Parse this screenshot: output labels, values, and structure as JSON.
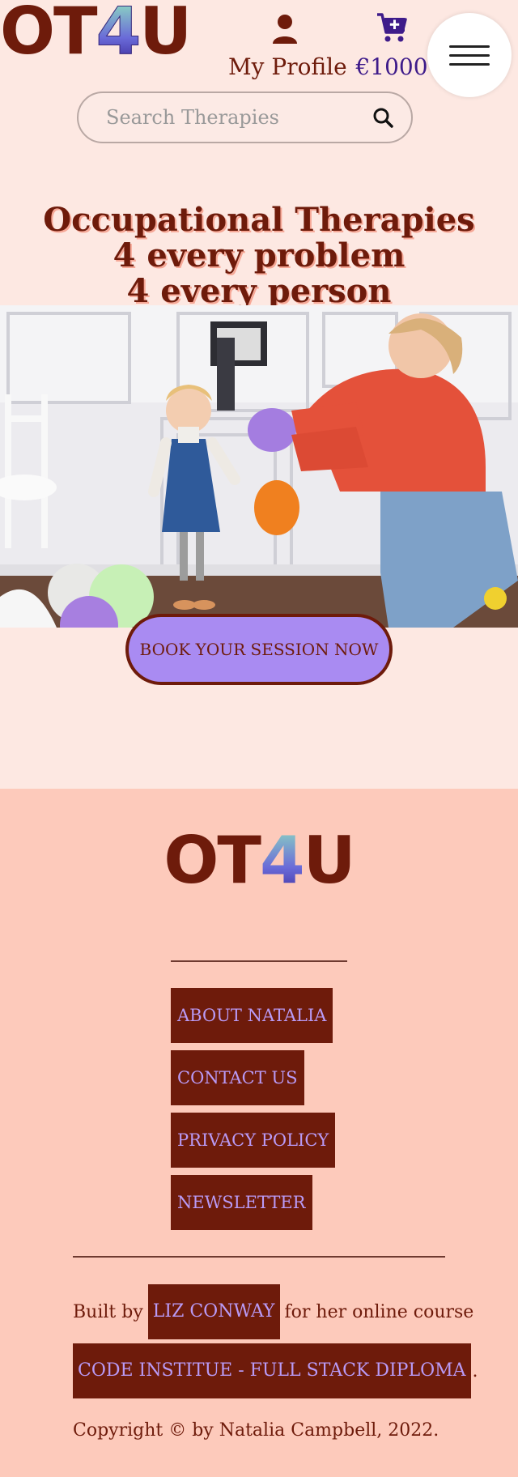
{
  "header": {
    "logo_text": "OT",
    "logo_four": "4",
    "logo_tail": "U",
    "profile_label": "My Profile",
    "cart_total": "€1000"
  },
  "search": {
    "placeholder": "Search Therapies"
  },
  "hero": {
    "line1": "Occupational Therapies",
    "line2": "4 every problem",
    "line3": "4 every person",
    "book_button": "BOOK YOUR SESSION NOW"
  },
  "footer": {
    "logo_text": "OT",
    "logo_four": "4",
    "logo_tail": "U",
    "nav": [
      "ABOUT NATALIA",
      "CONTACT US",
      "PRIVACY POLICY",
      "NEWSLETTER"
    ],
    "built_by": "Built by",
    "author": "LIZ CONWAY",
    "for_course": "for her online course",
    "course": "CODE INSTITUE - FULL STACK DIPLOMA",
    "period": ".",
    "copyright": "Copyright © by Natalia Campbell, 2022."
  },
  "colors": {
    "brand": "#6e1b0b",
    "accent": "#a98bf2",
    "link": "#b99af5",
    "cart": "#3e1b8a"
  }
}
